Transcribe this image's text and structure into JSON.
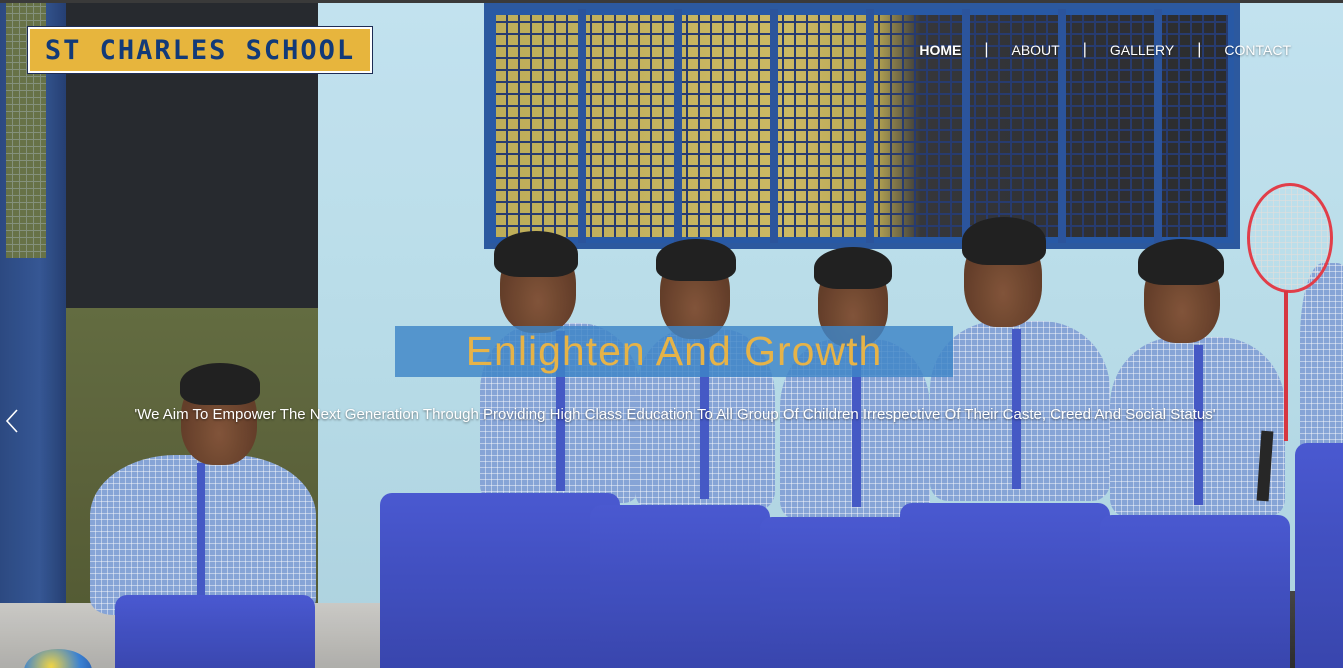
{
  "header": {
    "logo_text": "ST CHARLES SCHOOL"
  },
  "nav": {
    "items": [
      {
        "label": "HOME",
        "active": true
      },
      {
        "label": "ABOUT",
        "active": false
      },
      {
        "label": "GALLERY",
        "active": false
      },
      {
        "label": "CONTACT",
        "active": false
      }
    ],
    "separator": "|"
  },
  "hero": {
    "title": "Enlighten And Growth",
    "text": "'We Aim To Empower The Next Generation Through Providing High Class Education To All Group Of Children Irrespective Of Their Caste, Creed And Social Status'",
    "prev_icon": "chevron-left-icon"
  },
  "colors": {
    "logo_background": "#e7b53d",
    "logo_text": "#123a78",
    "caption_band": "#3e85c7",
    "caption_title": "#e6b348",
    "nav_text": "#ffffff"
  }
}
